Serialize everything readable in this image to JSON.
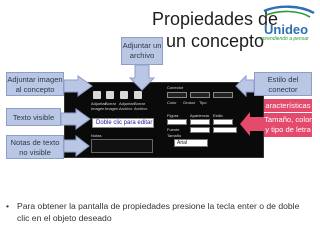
{
  "title": "Propiedades de un concepto",
  "logo": {
    "brand": "Unideo",
    "tagline": "aprendiendo a pensar"
  },
  "callouts": {
    "adjuntar_archivo": "Adjuntar un archivo",
    "adjuntar_imagen": "Adjuntar imagen al concepto",
    "texto_visible": "Texto visible",
    "notas": "Notas de texto no visible",
    "estilo_conector": "Estilo del conector",
    "caracteristicas": "aracterísticas",
    "tamano_color": "Tamaño, color y tipo de letra"
  },
  "dialog": {
    "tab_label": "iquetas",
    "toolbar_buttons": [
      "Adjuntar Imagen",
      "Borrar Imagen",
      "Adjuntar Archivo",
      "Borrar Archivo"
    ],
    "connector_label": "Conector",
    "color_label": "Color",
    "grosor_label": "Grosor",
    "tipo_label": "Tipo",
    "figura_label": "Figura",
    "apariencia_label": "Apariencia",
    "estilo_label": "Estilo",
    "fuente_label": "Fuente",
    "tamano_label": "Tamaño",
    "text_value": "Doble clic para editar",
    "font_value": "Arial",
    "notes_label": "Notas"
  },
  "bullet": "Para obtener la pantalla de propiedades presione la tecla enter o de doble clic en el objeto deseado",
  "colors": {
    "callout_blue": "#b9c6e4",
    "callout_red": "#e34a6b",
    "dialog_bg": "#0a0a0a",
    "logo_blue": "#2f6fb5",
    "logo_green": "#2a9a3a"
  }
}
